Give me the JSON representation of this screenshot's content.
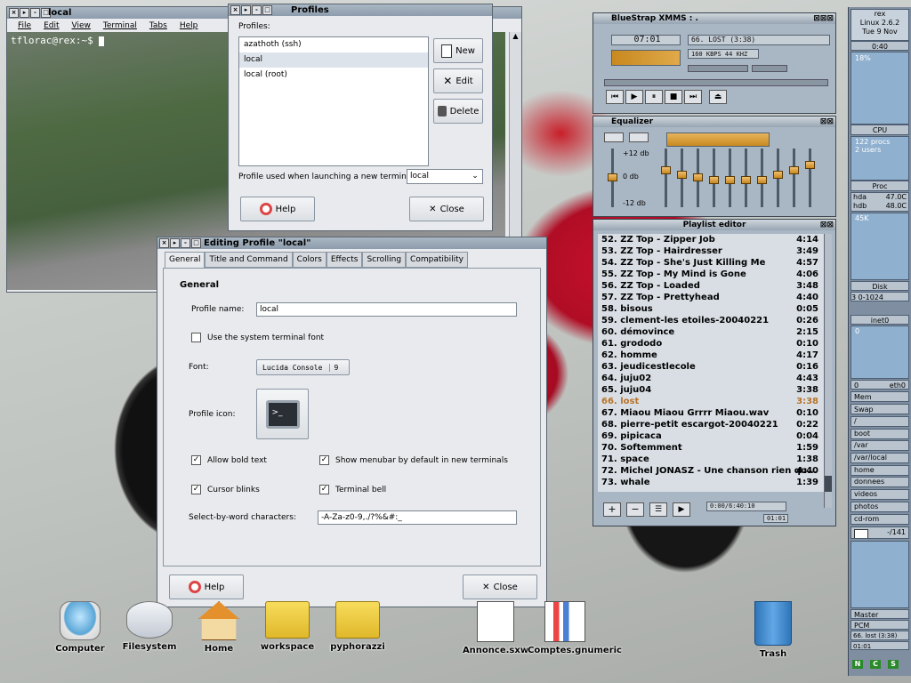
{
  "terminal": {
    "title": "local",
    "menu": [
      "File",
      "Edit",
      "View",
      "Terminal",
      "Tabs",
      "Help"
    ],
    "prompt": "tflorac@rex:~$"
  },
  "profiles": {
    "title": "Profiles",
    "label": "Profiles:",
    "items": [
      "azathoth (ssh)",
      "local",
      "local (root)"
    ],
    "selected": "local",
    "buttons": {
      "new": "New",
      "edit": "Edit",
      "delete": "Delete"
    },
    "launch_label": "Profile used when launching a new terminal:",
    "launch_value": "local",
    "help": "Help",
    "close": "Close"
  },
  "editing": {
    "title": "Editing Profile \"local\"",
    "tabs": [
      "General",
      "Title and Command",
      "Colors",
      "Effects",
      "Scrolling",
      "Compatibility"
    ],
    "active_tab": "General",
    "section": "General",
    "profile_name_label": "Profile name:",
    "profile_name": "local",
    "system_font_label": "Use the system terminal font",
    "font_label": "Font:",
    "font_value": "Lucida Console",
    "font_size": "9",
    "icon_label": "Profile icon:",
    "allow_bold": "Allow bold text",
    "show_menubar": "Show menubar by default in new terminals",
    "cursor_blinks": "Cursor blinks",
    "terminal_bell": "Terminal bell",
    "word_chars_label": "Select-by-word characters:",
    "word_chars": "-A-Za-z0-9,./?%&#:_",
    "help": "Help",
    "close": "Close"
  },
  "xmms": {
    "title": "BlueStrap XMMS : .",
    "time": "07:01",
    "song": "66. LOST (3:38)",
    "bitrate": "160 KBPS 44 KHZ"
  },
  "equalizer": {
    "title": "Equalizer",
    "plus": "+12 db",
    "zero": "0 db",
    "minus": "-12 db",
    "bands": [
      0.5,
      0.35,
      0.45,
      0.5,
      0.55,
      0.55,
      0.55,
      0.55,
      0.45,
      0.35,
      0.25
    ]
  },
  "playlist": {
    "title": "Playlist editor",
    "current": 14,
    "rows": [
      {
        "title": "52. ZZ Top - Zipper Job",
        "time": "4:14"
      },
      {
        "title": "53. ZZ Top - Hairdresser",
        "time": "3:49"
      },
      {
        "title": "54. ZZ Top - She's Just Killing Me",
        "time": "4:57"
      },
      {
        "title": "55. ZZ Top - My Mind is Gone",
        "time": "4:06"
      },
      {
        "title": "56. ZZ Top - Loaded",
        "time": "3:48"
      },
      {
        "title": "57. ZZ Top - Prettyhead",
        "time": "4:40"
      },
      {
        "title": "58. bisous",
        "time": "0:05"
      },
      {
        "title": "59. clement-les etoiles-20040221",
        "time": "0:26"
      },
      {
        "title": "60. démovince",
        "time": "2:15"
      },
      {
        "title": "61. grododo",
        "time": "0:10"
      },
      {
        "title": "62. homme",
        "time": "4:17"
      },
      {
        "title": "63. jeudicestlecole",
        "time": "0:16"
      },
      {
        "title": "64. juju02",
        "time": "4:43"
      },
      {
        "title": "65. juju04",
        "time": "3:38"
      },
      {
        "title": "66. lost",
        "time": "3:38"
      },
      {
        "title": "67. Miaou Miaou Grrrr Miaou.wav",
        "time": "0:10"
      },
      {
        "title": "68. pierre-petit escargot-20040221",
        "time": "0:22"
      },
      {
        "title": "69. pipicaca",
        "time": "0:04"
      },
      {
        "title": "70. Softemment",
        "time": "1:59"
      },
      {
        "title": "71. space",
        "time": "1:38"
      },
      {
        "title": "72. Michel JONASZ - Une chanson rien qu...",
        "time": "4:40"
      },
      {
        "title": "73. whale",
        "time": "1:39"
      }
    ],
    "total": "0:00/6:40:10",
    "pos": "01:01"
  },
  "gkrellm": {
    "host": "rex",
    "kernel": "Linux 2.6.2",
    "date": "Tue  9 Nov",
    "clock": "0:40",
    "cpu_pct": "18%",
    "cpu": "CPU",
    "procs": "122 procs",
    "users": "2 users",
    "proc": "Proc",
    "hda": "hda",
    "hda_t": "47.0C",
    "hdb": "hdb",
    "hdb_t": "48.0C",
    "disk_scale": "45K",
    "disk": "Disk",
    "net_scale": "3 0-1024",
    "inet0": "inet0",
    "zero": "0",
    "zero2": "0",
    "eth0": "eth0",
    "mem": "Mem",
    "swap": "Swap",
    "mounts": [
      "/",
      "boot",
      "/var",
      "/var/local",
      "home",
      "donnees",
      "videos",
      "photos",
      "cd-rom"
    ],
    "mail": "-/141",
    "master": "Master",
    "pcm": "PCM",
    "song": "66. lost (3:38)",
    "song_time": "01:01"
  },
  "desktop_icons": [
    {
      "name": "Computer"
    },
    {
      "name": "Filesystem"
    },
    {
      "name": "Home"
    },
    {
      "name": "workspace"
    },
    {
      "name": "pyphorazzi"
    },
    {
      "name": "Annonce.sxw"
    },
    {
      "name": "Comptes.gnumeric"
    },
    {
      "name": "Trash"
    }
  ],
  "colors": {
    "accent": "#8d9cac",
    "playlist_current": "#b8732a"
  }
}
